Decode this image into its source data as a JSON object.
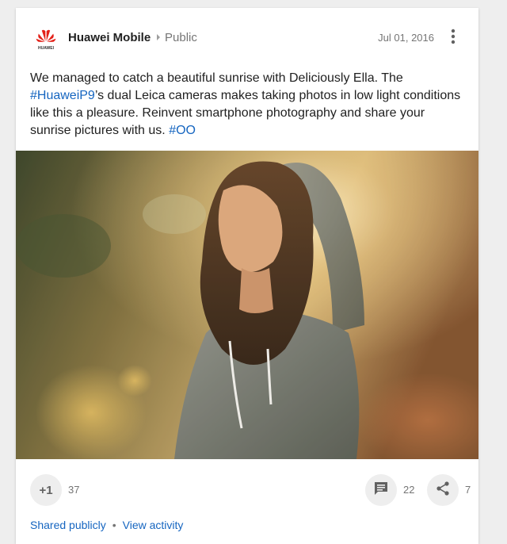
{
  "post": {
    "author": "Huawei Mobile",
    "logo_text": "HUAWEI",
    "visibility": "Public",
    "date": "Jul 01, 2016",
    "text_part1": "We managed to catch a beautiful sunrise with Deliciously Ella. The ",
    "hashtag1": "#HuaweiP9",
    "text_part2": "’s dual Leica cameras makes taking photos in low light conditions like this a pleasure. Reinvent smartphone photography and share your sunrise pictures with us. ",
    "hashtag2": "#OO"
  },
  "actions": {
    "plus_one_label": "+1",
    "plus_one_count": "37",
    "comment_count": "22",
    "share_count": "7"
  },
  "footer": {
    "shared_label": "Shared publicly",
    "separator": "•",
    "activity_label": "View activity"
  },
  "colors": {
    "link": "#1565c0",
    "brand_red": "#e32119"
  },
  "icons": {
    "logo": "huawei-logo-icon",
    "visibility_arrow": "chevron-right-icon",
    "menu": "more-vert-icon",
    "comment": "comment-icon",
    "share": "share-icon"
  }
}
